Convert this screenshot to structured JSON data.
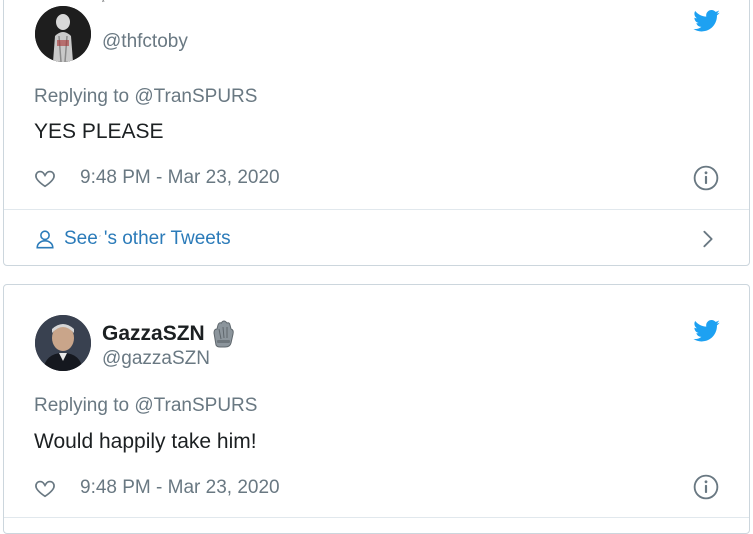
{
  "tweets": [
    {
      "display_name": "",
      "name_mark": "ﾞ",
      "handle": "@thfctoby",
      "reply_prefix": "Replying to ",
      "reply_to": "@TranSPURS",
      "text": "YES PLEASE",
      "timestamp": "9:48 PM - Mar 23, 2020",
      "other_tweets": {
        "prefix": "See",
        "mark": "ﾞ",
        "suffix": "'s other Tweets"
      }
    },
    {
      "display_name": "GazzaSZN",
      "handle": "@gazzaSZN",
      "reply_prefix": "Replying to ",
      "reply_to": "@TranSPURS",
      "text": "Would happily take him!",
      "timestamp": "9:48 PM - Mar 23, 2020"
    }
  ],
  "icons": {
    "brand": "twitter-bird-icon",
    "like": "heart-icon",
    "info": "info-icon",
    "profile": "person-icon",
    "next": "chevron-right-icon",
    "glove": "glove-emoji-icon"
  },
  "colors": {
    "twitter_blue": "#1da1f2",
    "link_blue": "#2b7bb9",
    "muted_text": "#697882",
    "border": "#ccd6dd"
  }
}
